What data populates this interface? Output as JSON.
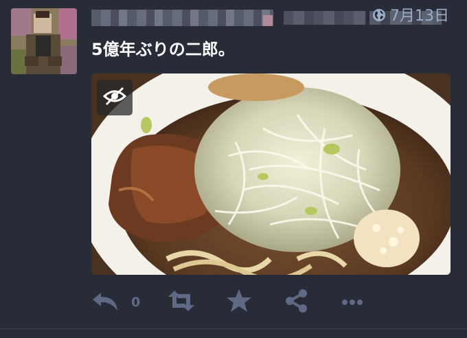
{
  "status": {
    "timestamp": "7月13日",
    "content": "5億年ぶりの二郎。",
    "reply_count": "0"
  },
  "icons": {
    "visibility": "globe-icon",
    "media_toggle": "eye-slash-icon",
    "reply": "reply-icon",
    "boost": "retweet-icon",
    "favourite": "star-icon",
    "share": "share-icon",
    "more": "ellipsis-icon"
  },
  "colors": {
    "background": "#282c37",
    "muted": "#9baec8",
    "action": "#606984",
    "text": "#ffffff"
  }
}
